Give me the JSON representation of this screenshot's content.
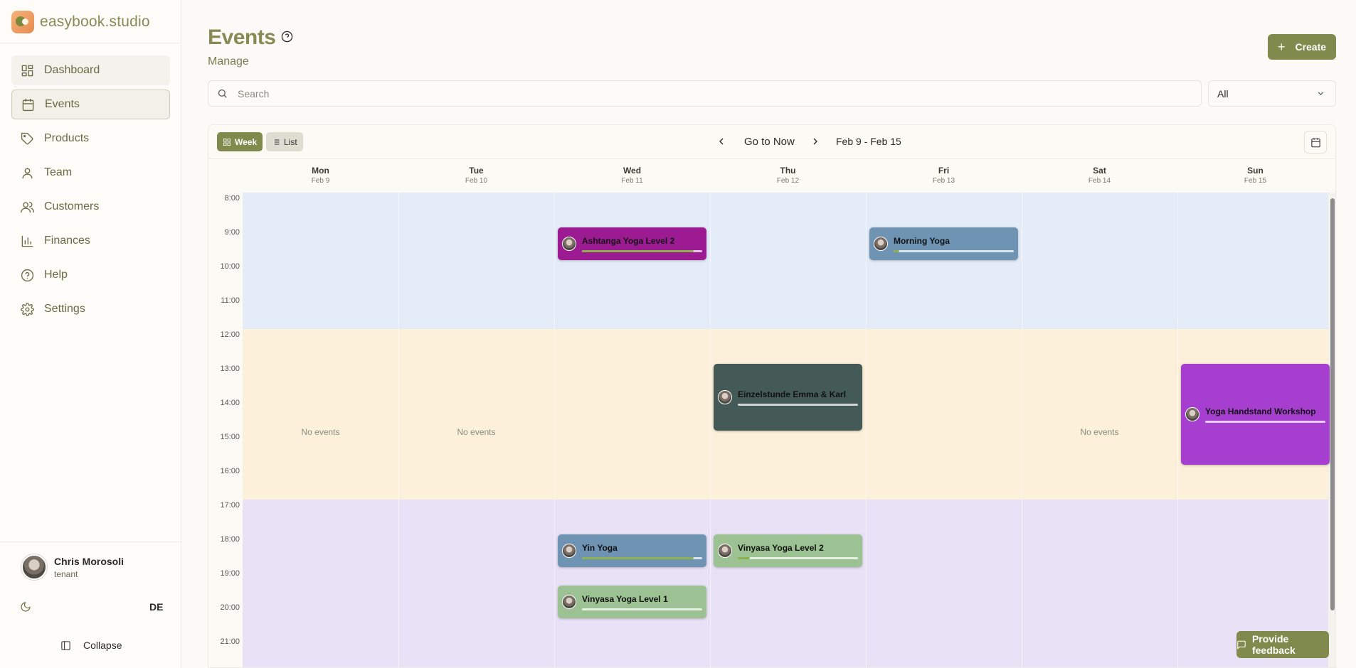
{
  "brand": {
    "name": "easybook.studio"
  },
  "sidebar": {
    "items": [
      {
        "label": "Dashboard",
        "icon": "dashboard-icon"
      },
      {
        "label": "Events",
        "icon": "calendar-icon"
      },
      {
        "label": "Products",
        "icon": "tag-icon"
      },
      {
        "label": "Team",
        "icon": "user-icon"
      },
      {
        "label": "Customers",
        "icon": "users-icon"
      },
      {
        "label": "Finances",
        "icon": "bar-chart-icon"
      },
      {
        "label": "Help",
        "icon": "help-circle-icon"
      },
      {
        "label": "Settings",
        "icon": "gear-icon"
      }
    ],
    "user": {
      "name": "Chris Morosoli",
      "role": "tenant"
    },
    "language": "DE",
    "collapse_label": "Collapse"
  },
  "header": {
    "title": "Events",
    "subtitle": "Manage",
    "create_label": "Create"
  },
  "search": {
    "placeholder": "Search"
  },
  "filter": {
    "selected": "All"
  },
  "calendar": {
    "view_week": "Week",
    "view_list": "List",
    "go_now": "Go to Now",
    "range": "Feb 9 - Feb 15",
    "days": [
      {
        "name": "Mon",
        "date": "Feb 9"
      },
      {
        "name": "Tue",
        "date": "Feb 10"
      },
      {
        "name": "Wed",
        "date": "Feb 11"
      },
      {
        "name": "Thu",
        "date": "Feb 12"
      },
      {
        "name": "Fri",
        "date": "Feb 13"
      },
      {
        "name": "Sat",
        "date": "Feb 14"
      },
      {
        "name": "Sun",
        "date": "Feb 15"
      }
    ],
    "hours": [
      "8:00",
      "9:00",
      "10:00",
      "11:00",
      "12:00",
      "13:00",
      "14:00",
      "15:00",
      "16:00",
      "17:00",
      "18:00",
      "19:00",
      "20:00",
      "21:00"
    ],
    "no_events_label": "No events",
    "events": [
      {
        "title": "Ashtanga Yoga Level 2",
        "day": "Wed",
        "start": "9:00",
        "end": "10:00",
        "color": "#9c1a92",
        "progress": 0.93
      },
      {
        "title": "Morning Yoga",
        "day": "Fri",
        "start": "9:00",
        "end": "10:00",
        "color": "#6e93b3",
        "progress": 0.05
      },
      {
        "title": "Einzelstunde Emma & Karl",
        "day": "Thu",
        "start": "13:00",
        "end": "15:00",
        "color": "#435a57",
        "progress": 0.0
      },
      {
        "title": "Yoga Handstand Workshop",
        "day": "Sun",
        "start": "13:00",
        "end": "16:00",
        "color": "#a63fd0",
        "progress": 0.0
      },
      {
        "title": "Yin Yoga",
        "day": "Wed",
        "start": "18:00",
        "end": "19:00",
        "color": "#6e93b3",
        "progress": 0.93
      },
      {
        "title": "Vinyasa Yoga Level 2",
        "day": "Thu",
        "start": "18:00",
        "end": "19:00",
        "color": "#9cc293",
        "progress": 0.1
      },
      {
        "title": "Vinyasa Yoga Level 1",
        "day": "Wed",
        "start": "19:30",
        "end": "20:30",
        "color": "#9cc293",
        "progress": 0.0
      }
    ]
  },
  "feedback_label": "Provide feedback",
  "colors": {
    "accent": "#7f8a4c",
    "brand_text": "#8a8a57"
  }
}
